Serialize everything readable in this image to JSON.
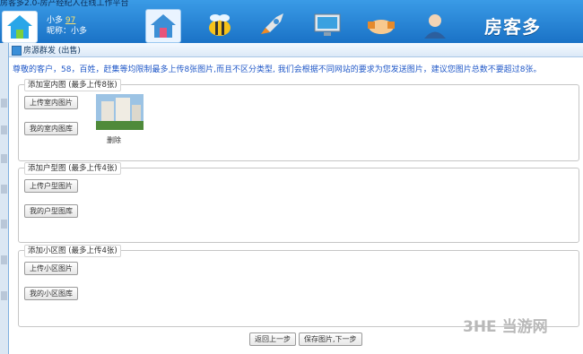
{
  "app": {
    "title": "房客多2.0-房产经纪人在线工作平台",
    "brand": "房客多"
  },
  "user": {
    "name": "小多",
    "count": "97",
    "nickname_label": "昵称：小多"
  },
  "nav": {
    "icons": [
      "home-icon",
      "bee-icon",
      "rocket-icon",
      "monitor-icon",
      "handshake-icon",
      "person-icon"
    ]
  },
  "dialog": {
    "title": "房源群发 (出售)",
    "notice": "尊敬的客户，58，百姓，赶集等均限制最多上传8张图片,而且不区分类型, 我们会根据不同网站的要求为您发送图片，建议您图片总数不要超过8张。",
    "sections": [
      {
        "legend": "添加室内图 (最多上传8张)",
        "upload": "上传室内图片",
        "library": "我的室内图库",
        "delete": "删除"
      },
      {
        "legend": "添加户型图 (最多上传4张)",
        "upload": "上传户型图片",
        "library": "我的户型图库"
      },
      {
        "legend": "添加小区图 (最多上传4张)",
        "upload": "上传小区图片",
        "library": "我的小区图库"
      }
    ],
    "footer": {
      "back": "返回上一步",
      "next": "保存图片,下一步"
    }
  },
  "watermark": "3HE 当游网"
}
